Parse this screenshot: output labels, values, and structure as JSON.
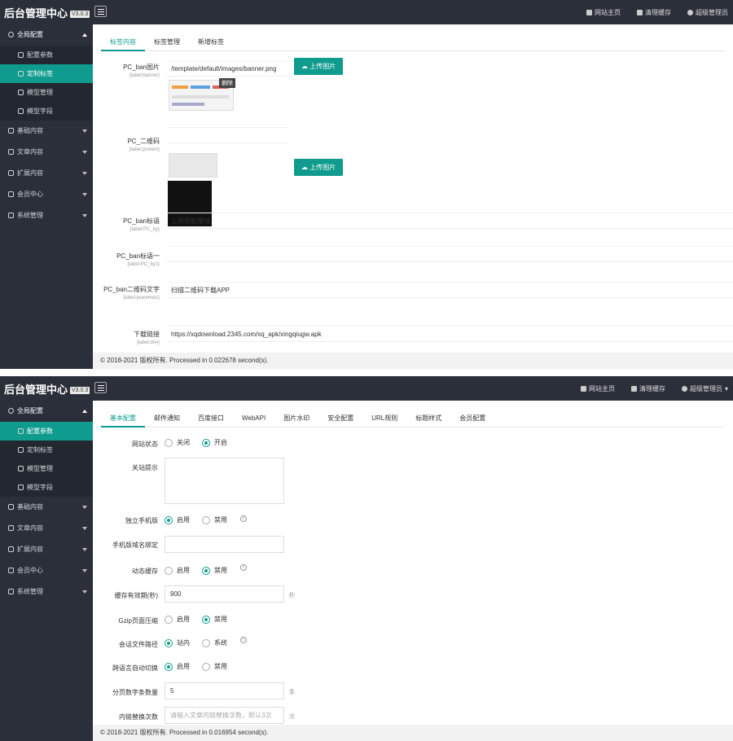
{
  "app": {
    "title": "后台管理中心",
    "version": "V3.0.3"
  },
  "top_links": {
    "home": "网站主页",
    "cache": "清理缓存",
    "user": "超级管理员"
  },
  "panel1": {
    "sidebar": {
      "global": "全局配置",
      "config_params": "配置参数",
      "custom_tags": "定制标签",
      "model_manage": "模型管理",
      "model_fields": "模型字段",
      "basic": "基础内容",
      "article": "文章内容",
      "extend": "扩展内容",
      "member": "会员中心",
      "system": "系统管理"
    },
    "tabs": [
      "标签内容",
      "标签管理",
      "新增标签"
    ],
    "fields": {
      "banner_label": "PC_ban图片",
      "banner_sub": "{label:banner}",
      "banner_value": "/template/default/images/banner.png",
      "upload_label": "上传图片",
      "delete_label": "删除",
      "pcewm_label": "PC_二维码",
      "pcewm_sub": "{label:pcewm}",
      "pcby_label": "PC_ban标语",
      "pcby_sub": "{label:PC_by}",
      "pcby_value": "上网就能赚钱",
      "pcby1_label": "PC_ban标语一",
      "pcby1_sub": "{label:PC_by1}",
      "pcby1_value": "",
      "pcewmwz_label": "PC_ban二维码文字",
      "pcewmwz_sub": "{label:pcewmwz}",
      "pcewmwz_value": "扫描二维码下载APP",
      "download_label": "下载链接",
      "download_sub": "{label:dnv}",
      "download_value": "https://xqdownload.2345.com/xq_apk/xingqiugw.apk"
    },
    "footer": "© 2018-2021 版权所有. Processed in 0.022678 second(s)."
  },
  "panel2": {
    "sidebar": {
      "global": "全局配置",
      "config_params": "配置参数",
      "custom_tags": "定制标签",
      "model_manage": "模型管理",
      "model_fields": "模型字段",
      "basic": "基础内容",
      "article": "文章内容",
      "extend": "扩展内容",
      "member": "会员中心",
      "system": "系统管理"
    },
    "tabs": [
      "基本配置",
      "邮件通知",
      "百度接口",
      "WebAPI",
      "图片水印",
      "安全配置",
      "URL规则",
      "标题样式",
      "会员配置"
    ],
    "form": {
      "site_status": "网站状态",
      "opt_close": "关闭",
      "opt_open": "开启",
      "close_tip": "关站提示",
      "mobile_site": "独立手机版",
      "opt_enable": "启用",
      "opt_disable": "禁用",
      "mobile_domain": "手机版域名绑定",
      "dynamic_cache": "动态缓存",
      "cache_time": "缓存有效期(秒)",
      "cache_time_value": "900",
      "cache_time_unit": "秒",
      "gzip": "Gzip页面压缩",
      "session_path": "会话文件路径",
      "opt_inner": "站内",
      "opt_system": "系统",
      "lang_switch": "跨语言自动切换",
      "page_num": "分页数字条数量",
      "page_num_value": "5",
      "page_num_unit": "条",
      "inner_link": "内链替换次数",
      "inner_link_placeholder": "请输入文章内链替换次数，默认3次",
      "inner_link_unit": "次"
    },
    "footer": "© 2018-2021 版权所有. Processed in 0.016954 second(s)."
  },
  "colors": {
    "accent": "#0f9b8e",
    "dark": "#2a2f3a"
  }
}
